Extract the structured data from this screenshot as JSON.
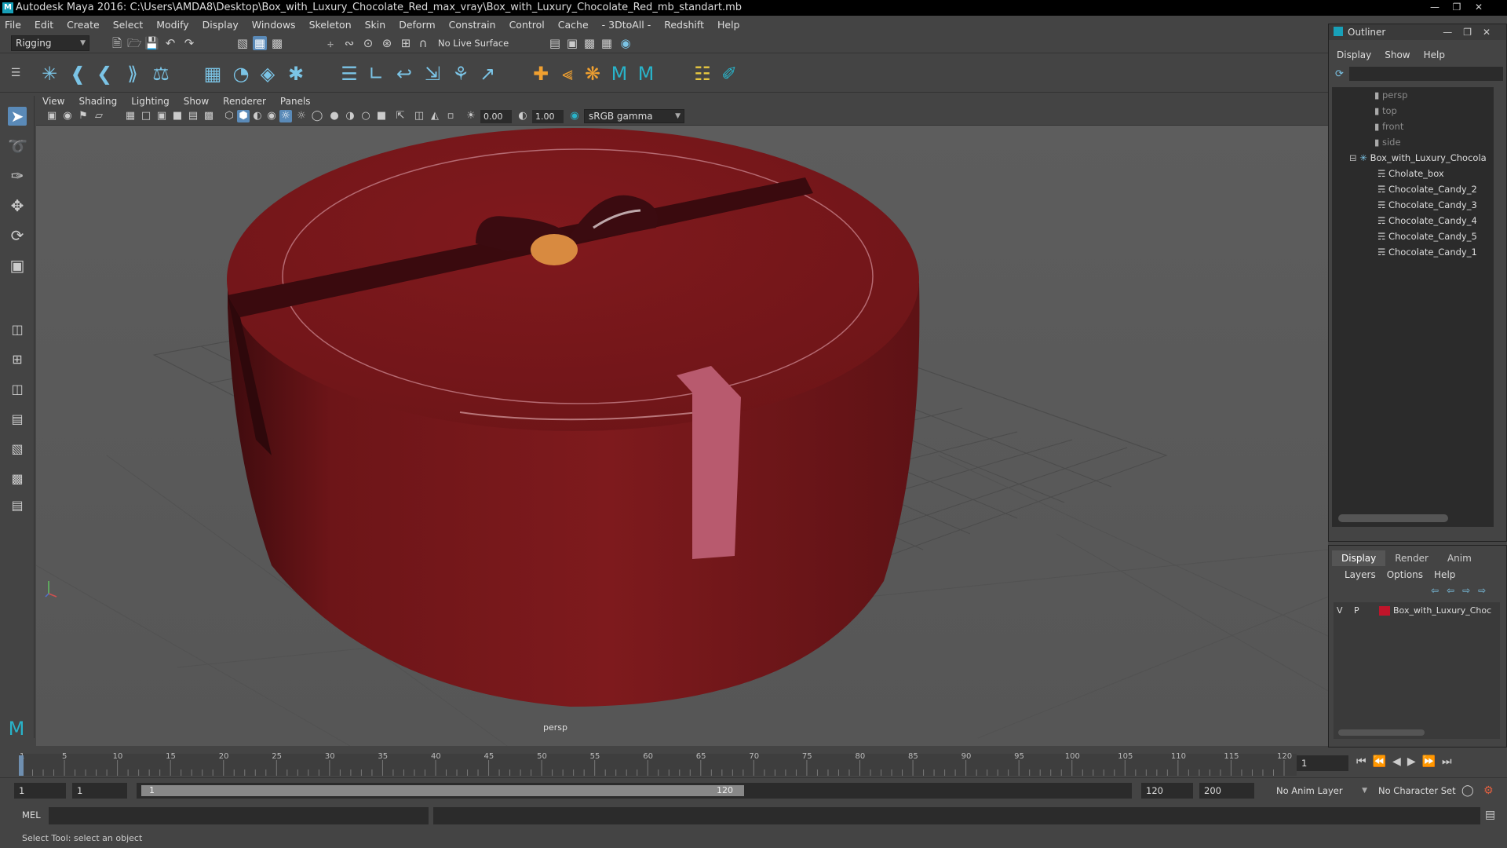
{
  "window": {
    "title": "Autodesk Maya 2016: C:\\Users\\AMDA8\\Desktop\\Box_with_Luxury_Chocolate_Red_max_vray\\Box_with_Luxury_Chocolate_Red_mb_standart.mb"
  },
  "menubar": [
    "File",
    "Edit",
    "Create",
    "Select",
    "Modify",
    "Display",
    "Windows",
    "Skeleton",
    "Skin",
    "Deform",
    "Constrain",
    "Control",
    "Cache",
    "- 3DtoAll -",
    "Redshift",
    "Help"
  ],
  "toolbar": {
    "mode": "Rigging",
    "live_surface": "No Live Surface"
  },
  "viewport_menu": [
    "View",
    "Shading",
    "Lighting",
    "Show",
    "Renderer",
    "Panels"
  ],
  "viewport_toolbar": {
    "exposure": "0.00",
    "gamma": "1.00",
    "color_space": "sRGB gamma"
  },
  "viewport": {
    "camera_label": "persp"
  },
  "outliner": {
    "title": "Outliner",
    "menu": [
      "Display",
      "Show",
      "Help"
    ],
    "items": [
      {
        "label": "persp",
        "type": "camera"
      },
      {
        "label": "top",
        "type": "camera"
      },
      {
        "label": "front",
        "type": "camera"
      },
      {
        "label": "side",
        "type": "camera"
      },
      {
        "label": "Box_with_Luxury_Chocola",
        "type": "group"
      },
      {
        "label": "Cholate_box",
        "type": "mesh"
      },
      {
        "label": "Chocolate_Candy_2",
        "type": "mesh"
      },
      {
        "label": "Chocolate_Candy_3",
        "type": "mesh"
      },
      {
        "label": "Chocolate_Candy_4",
        "type": "mesh"
      },
      {
        "label": "Chocolate_Candy_5",
        "type": "mesh"
      },
      {
        "label": "Chocolate_Candy_1",
        "type": "mesh"
      }
    ]
  },
  "layer_panel": {
    "tabs": [
      "Display",
      "Render",
      "Anim"
    ],
    "menu": [
      "Layers",
      "Options",
      "Help"
    ],
    "layer": {
      "v": "V",
      "p": "P",
      "name": "Box_with_Luxury_Choc",
      "color": "#c0142a"
    }
  },
  "timeline": {
    "ticks": [
      "1",
      "5",
      "10",
      "15",
      "20",
      "25",
      "30",
      "35",
      "40",
      "45",
      "50",
      "55",
      "60",
      "65",
      "70",
      "75",
      "80",
      "85",
      "90",
      "95",
      "100",
      "105",
      "110",
      "115",
      "120"
    ],
    "current_frame": "1"
  },
  "range": {
    "start": "1",
    "start2": "1",
    "slider_start": "1",
    "slider_end": "120",
    "end": "120",
    "end2": "200",
    "anim_layer": "No Anim Layer",
    "character_set": "No Character Set"
  },
  "command": {
    "label": "MEL"
  },
  "help_line": "Select Tool: select an object"
}
